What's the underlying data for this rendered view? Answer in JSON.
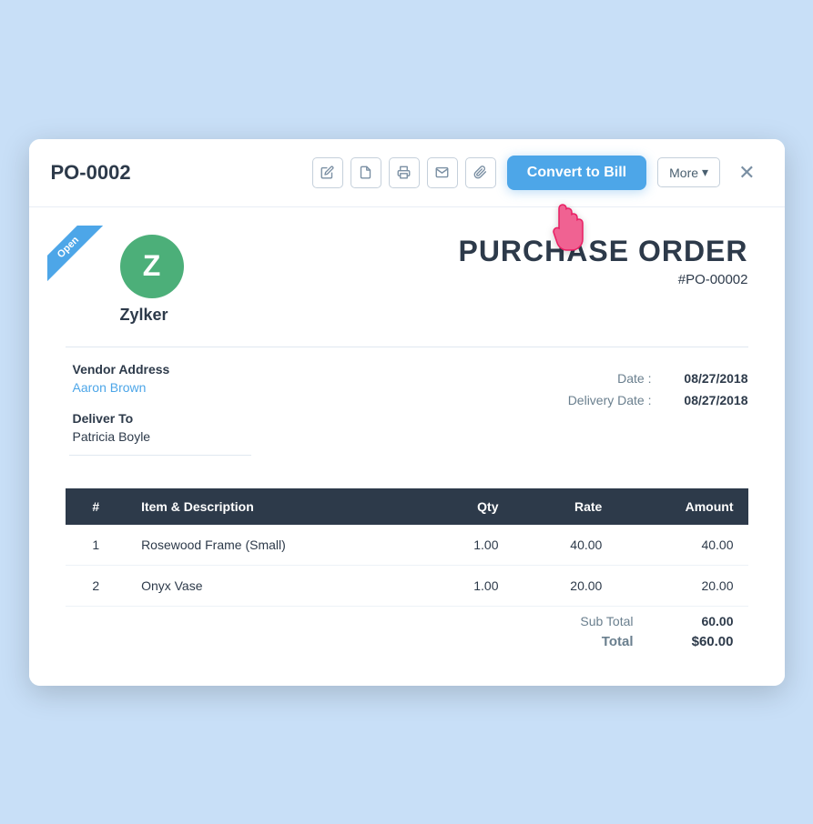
{
  "header": {
    "title": "PO-0002",
    "convert_btn": "Convert to Bill",
    "more_label": "More",
    "icons": [
      "edit",
      "pdf",
      "print",
      "email",
      "attach"
    ]
  },
  "ribbon": {
    "label": "Open"
  },
  "document": {
    "company": {
      "initial": "Z",
      "name": "Zylker"
    },
    "title": "PURCHASE ORDER",
    "number": "#PO-00002",
    "vendor_address_label": "Vendor Address",
    "vendor_name": "Aaron Brown",
    "deliver_to_label": "Deliver To",
    "deliver_name": "Patricia Boyle",
    "date_label": "Date :",
    "date_value": "08/27/2018",
    "delivery_date_label": "Delivery Date :",
    "delivery_date_value": "08/27/2018",
    "table": {
      "columns": [
        "#",
        "Item & Description",
        "Qty",
        "Rate",
        "Amount"
      ],
      "rows": [
        {
          "num": "1",
          "desc": "Rosewood Frame (Small)",
          "qty": "1.00",
          "rate": "40.00",
          "amount": "40.00"
        },
        {
          "num": "2",
          "desc": "Onyx Vase",
          "qty": "1.00",
          "rate": "20.00",
          "amount": "20.00"
        }
      ],
      "subtotal_label": "Sub Total",
      "subtotal_value": "60.00",
      "total_label": "Total",
      "total_value": "$60.00"
    }
  }
}
